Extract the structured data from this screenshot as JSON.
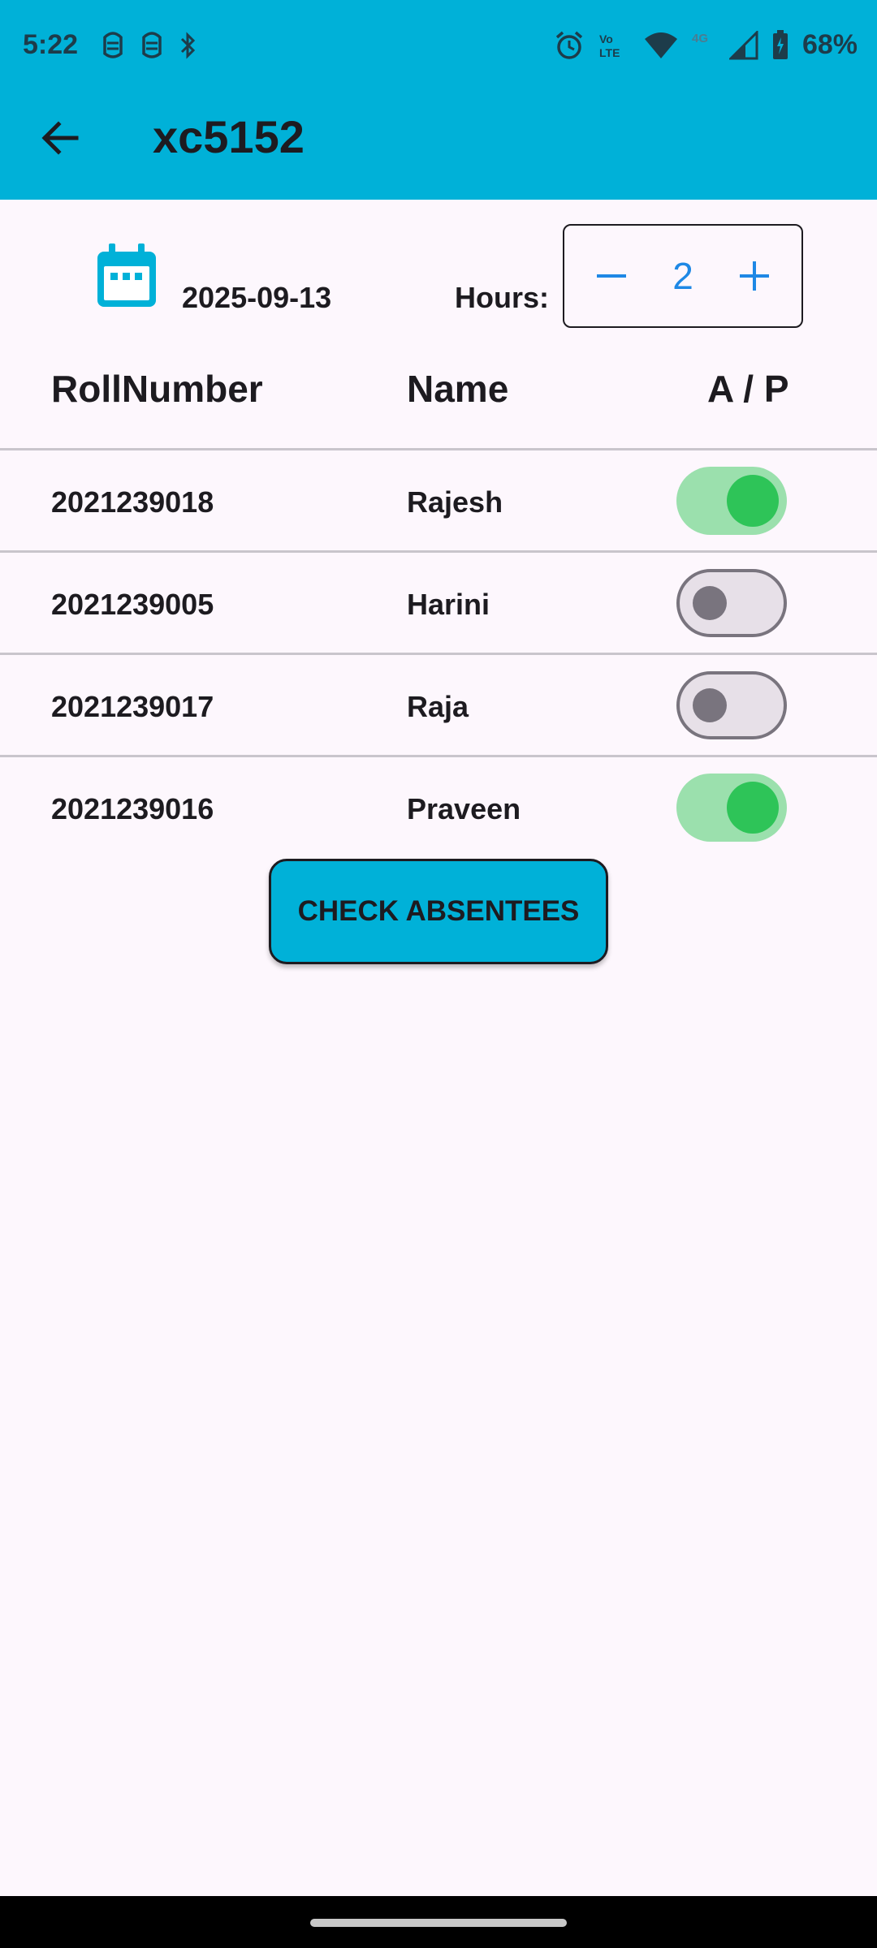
{
  "status_bar": {
    "time": "5:22",
    "battery": "68%",
    "icons": [
      "notification-icon",
      "notification-icon",
      "bluetooth-icon",
      "alarm-icon",
      "volte-icon",
      "wifi-icon",
      "4g-icon",
      "signal-icon",
      "battery-icon"
    ]
  },
  "app_bar": {
    "title": "xc5152",
    "back_icon": "arrow-back-icon"
  },
  "controls": {
    "date": "2025-09-13",
    "hours_label": "Hours:",
    "hours_value": "2",
    "minus_icon": "minus-icon",
    "plus_icon": "plus-icon"
  },
  "table": {
    "headers": [
      "RollNumber",
      "Name",
      "A / P"
    ],
    "rows": [
      {
        "roll": "2021239018",
        "name": "Rajesh",
        "present": true
      },
      {
        "roll": "2021239005",
        "name": "Harini",
        "present": false
      },
      {
        "roll": "2021239017",
        "name": "Raja",
        "present": false
      },
      {
        "roll": "2021239016",
        "name": "Praveen",
        "present": true
      }
    ]
  },
  "button": {
    "label": "CHECK ABSENTEES"
  },
  "colors": {
    "accent": "#00b1d8",
    "switch_on": "#2ec458",
    "background": "#fdf7fd"
  }
}
